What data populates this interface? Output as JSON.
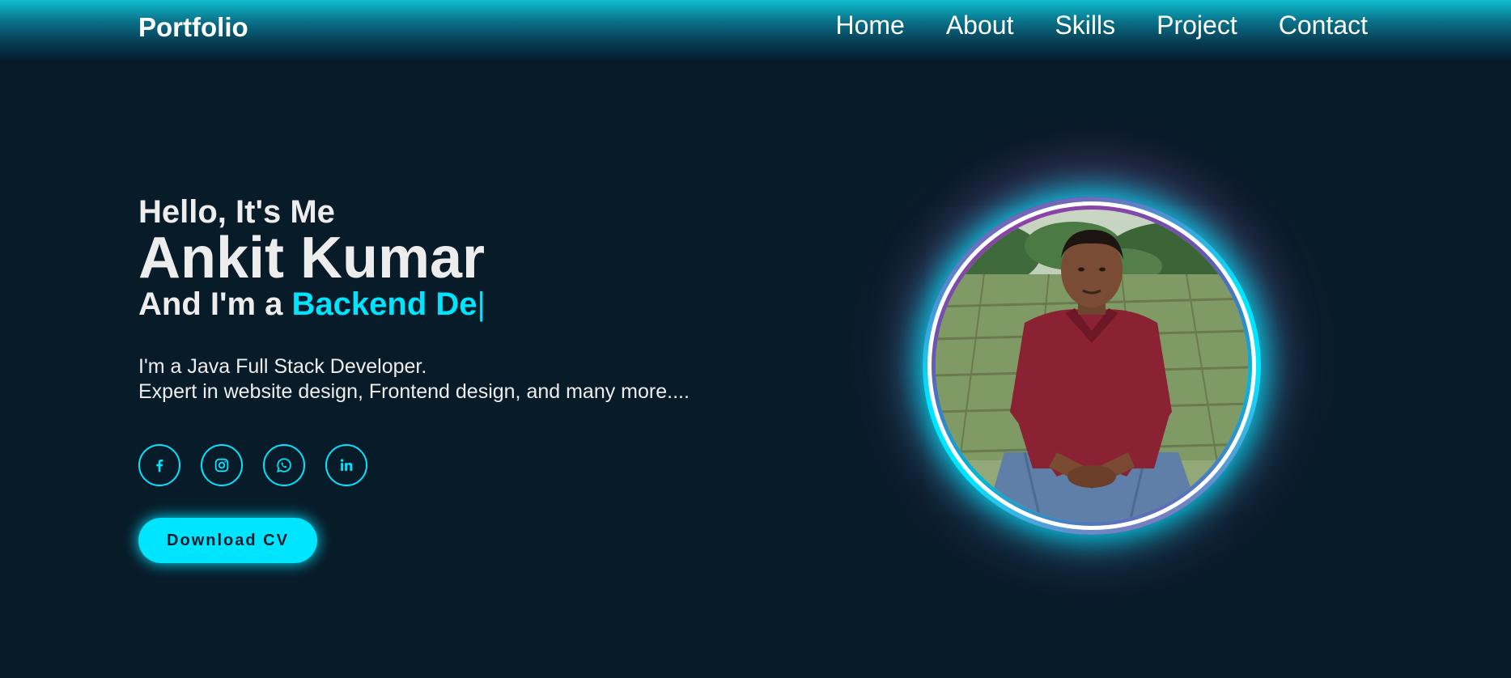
{
  "header": {
    "logo": "Portfolio",
    "nav": [
      {
        "label": "Home"
      },
      {
        "label": "About"
      },
      {
        "label": "Skills"
      },
      {
        "label": "Project"
      },
      {
        "label": "Contact"
      }
    ]
  },
  "hero": {
    "greeting": "Hello, It's Me",
    "name": "Ankit Kumar",
    "role_prefix": "And I'm a ",
    "role_typed": "Backend De",
    "cursor": "|",
    "description_line1": "I'm a Java Full Stack Developer.",
    "description_line2": "Expert in website design, Frontend design, and many more....",
    "social": [
      {
        "icon": "facebook-icon"
      },
      {
        "icon": "instagram-icon"
      },
      {
        "icon": "whatsapp-icon"
      },
      {
        "icon": "linkedin-icon"
      }
    ],
    "cta_label": "Download CV"
  },
  "colors": {
    "background": "#081b29",
    "accent": "#00e5ff",
    "text": "#ededed"
  }
}
